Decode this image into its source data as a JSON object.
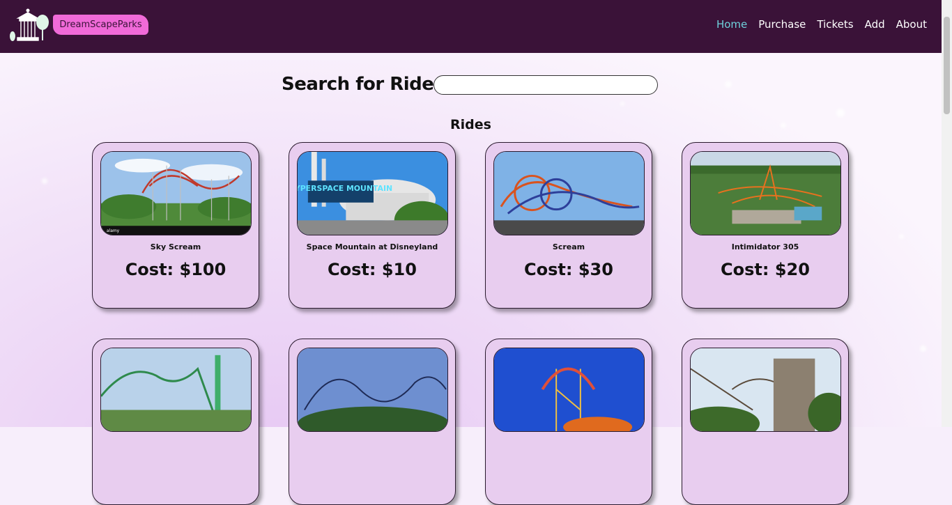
{
  "brand": {
    "name": "DreamScapeParks"
  },
  "nav": {
    "items": [
      "Home",
      "Purchase",
      "Tickets",
      "Add",
      "About"
    ],
    "active": "Home"
  },
  "search": {
    "label": "Search for Rides:",
    "value": "",
    "placeholder": ""
  },
  "section": {
    "title": "Rides"
  },
  "rides": [
    {
      "name": "Sky Scream",
      "cost": "Cost: $100"
    },
    {
      "name": "Space Mountain at Disneyland",
      "cost": "Cost: $10",
      "sign": "HYPERSPACE MOUNTAIN"
    },
    {
      "name": "Scream",
      "cost": "Cost: $30"
    },
    {
      "name": "Intimidator 305",
      "cost": "Cost: $20"
    },
    {
      "name": "",
      "cost": ""
    },
    {
      "name": "",
      "cost": ""
    },
    {
      "name": "",
      "cost": ""
    },
    {
      "name": "",
      "cost": ""
    }
  ],
  "photo_watermark": "alamy",
  "colors": {
    "navbar": "#3a1238",
    "brand_badge": "#f06ad8",
    "nav_active": "#6fd1dc",
    "card_bg": "#e8cdef"
  }
}
